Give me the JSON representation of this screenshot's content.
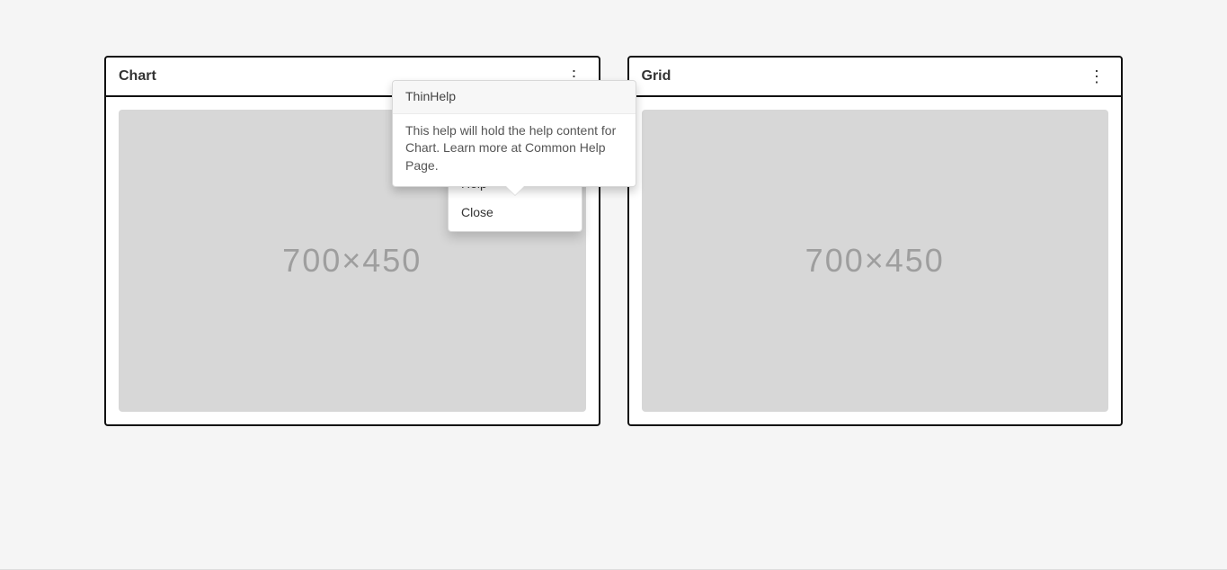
{
  "cards": {
    "chart": {
      "title": "Chart",
      "placeholder": "700×450"
    },
    "grid": {
      "title": "Grid",
      "placeholder": "700×450"
    }
  },
  "dropdown": {
    "items": [
      {
        "label": "Help"
      },
      {
        "label": "Close"
      }
    ]
  },
  "popover": {
    "title": "ThinHelp",
    "body": "This help will hold the help content for Chart. Learn more at Common Help Page."
  }
}
